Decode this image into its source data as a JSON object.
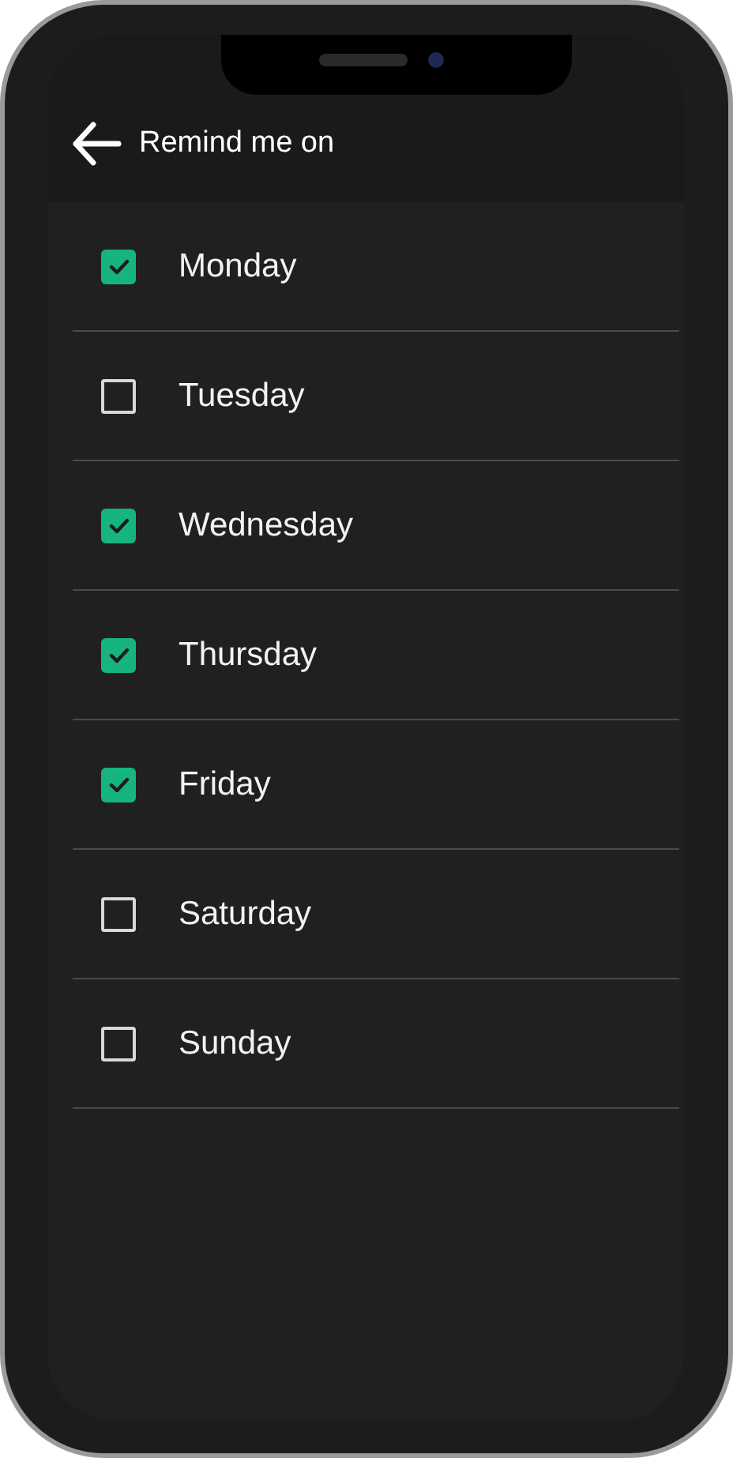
{
  "header": {
    "title": "Remind me on"
  },
  "days": [
    {
      "label": "Monday",
      "checked": true
    },
    {
      "label": "Tuesday",
      "checked": false
    },
    {
      "label": "Wednesday",
      "checked": true
    },
    {
      "label": "Thursday",
      "checked": true
    },
    {
      "label": "Friday",
      "checked": true
    },
    {
      "label": "Saturday",
      "checked": false
    },
    {
      "label": "Sunday",
      "checked": false
    }
  ]
}
